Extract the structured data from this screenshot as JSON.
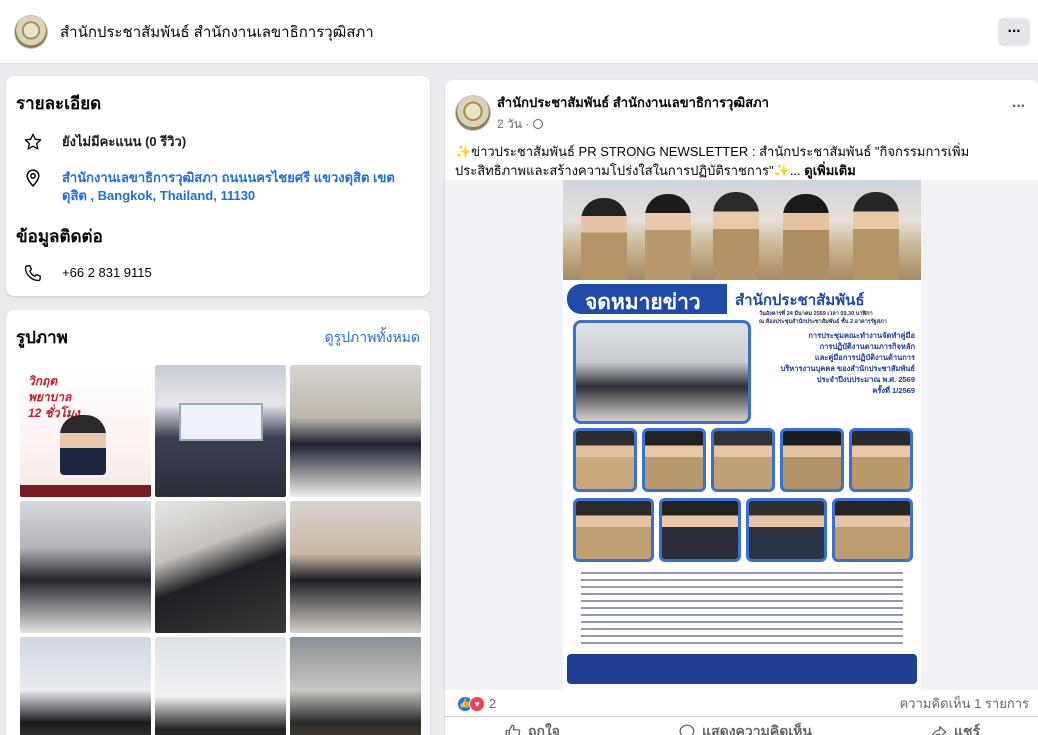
{
  "page": {
    "title": "สำนักประชาสัมพันธ์ สำนักงานเลขาธิการวุฒิสภา",
    "more_label": "···"
  },
  "details": {
    "heading": "รายละเอียด",
    "rating": "ยังไม่มีคะแนน (0 รีวิว)",
    "address": "สำนักงานเลขาธิการวุฒิสภา ถนนนครไชยศรี แขวงดุสิต เขตดุสิต , Bangkok, Thailand, 11130",
    "contact_heading": "ข้อมูลติดต่อ",
    "phone": "+66 2 831 9115"
  },
  "photos": {
    "heading": "รูปภาพ",
    "see_all": "ดูรูปภาพทั้งหมด",
    "first_photo_caption": "วิกฤตพยาบาล 12 ชั่วโมง"
  },
  "post": {
    "author": "สำนักประชาสัมพันธ์ สำนักงานเลขาธิการวุฒิสภา",
    "time": "2 วัน · ",
    "text": "✨ข่าวประชาสัมพันธ์ PR STRONG NEWSLETTER : สำนักประชาสัมพันธ์ \"กิจกรรมการเพิ่มประสิทธิภาพและสร้างความโปร่งใสในการปฏิบัติราชการ\"✨...",
    "see_more": "ดูเพิ่มเติม",
    "newsletter": {
      "banner": "จดหมายข่าว",
      "org": "สำนักประชาสัมพันธ์",
      "meeting_line1": "วันอังคารที่ 24 มีนาคม 2569 เวลา 09.30 นาฬิกา",
      "meeting_line2": "ณ ห้องประชุมสำนักประชาสัมพันธ์ ชั้น 2 อาคารรัฐสภา",
      "headline1": "การประชุมคณะทำงานจัดทำคู่มือ",
      "headline2": "การปฏิบัติงานตามภารกิจหลัก",
      "headline3": "และคู่มือการปฏิบัติงานด้านการ",
      "headline4": "บริหารงานบุคคล ของสำนักประชาสัมพันธ์",
      "headline5": "ประจำปีงบประมาณ พ.ศ. 2569",
      "headline6": "ครั้งที่ 1/2569"
    },
    "reaction_count": "2",
    "comment_count": "ความคิดเห็น 1 รายการ",
    "like_label": "ถูกใจ",
    "comment_label": "แสดงความคิดเห็น",
    "share_label": "แชร์"
  }
}
